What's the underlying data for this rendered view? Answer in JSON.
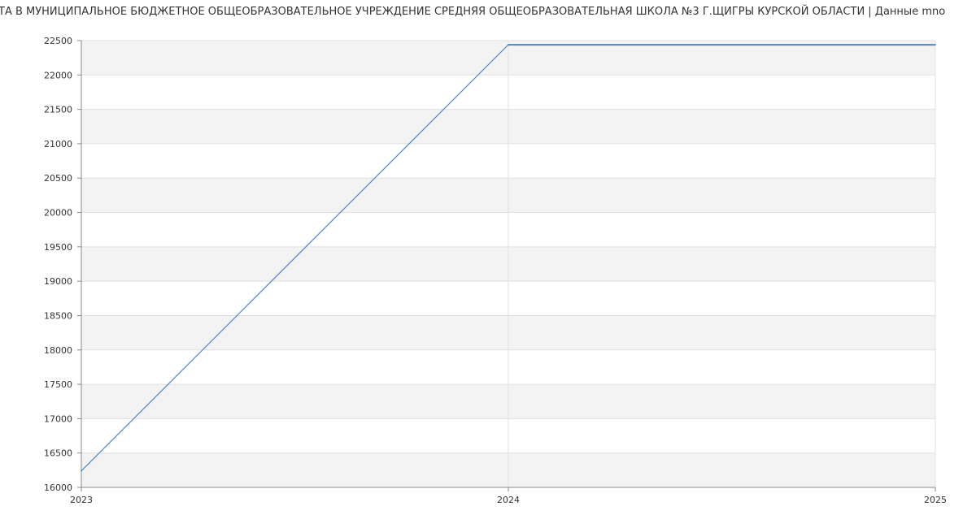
{
  "chart_data": {
    "type": "line",
    "title": "ТА В МУНИЦИПАЛЬНОЕ БЮДЖЕТНОЕ ОБЩЕОБРАЗОВАТЕЛЬНОЕ УЧРЕЖДЕНИЕ СРЕДНЯЯ ОБЩЕОБРАЗОВАТЕЛЬНАЯ ШКОЛА №3 Г.ЩИГРЫ КУРСКОЙ ОБЛАСТИ | Данные mno",
    "x": [
      2023,
      2024,
      2025
    ],
    "x_ticks": [
      "2023",
      "2024",
      "2025"
    ],
    "xlim": [
      2023,
      2025
    ],
    "ylim": [
      16000,
      22500
    ],
    "y_ticks": [
      "16000",
      "16500",
      "17000",
      "17500",
      "18000",
      "18500",
      "19000",
      "19500",
      "20000",
      "20500",
      "21000",
      "21500",
      "22000",
      "22500"
    ],
    "series": [
      {
        "values": [
          16240,
          22440,
          22440
        ],
        "color": "#4a86c8"
      }
    ],
    "grid": true,
    "band_color": "#f3f3f3",
    "grid_color": "#e0e0e0",
    "axis_color": "#888888"
  }
}
